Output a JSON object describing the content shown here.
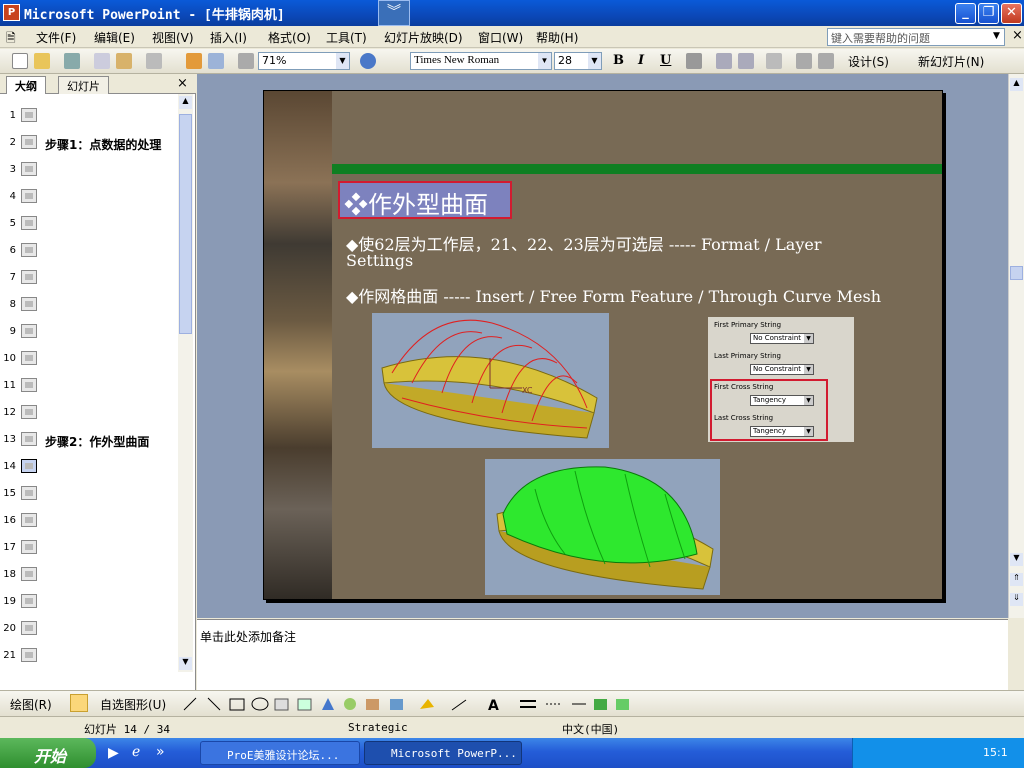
{
  "window": {
    "title": "Microsoft PowerPoint - [牛排锅肉机]",
    "app_icon": "P"
  },
  "menu": {
    "items": [
      "文件(F)",
      "编辑(E)",
      "视图(V)",
      "插入(I)",
      "格式(O)",
      "工具(T)",
      "幻灯片放映(D)",
      "窗口(W)",
      "帮助(H)"
    ],
    "help_placeholder": "键入需要帮助的问题"
  },
  "toolbar": {
    "zoom": "71%",
    "font": "Times New Roman",
    "size": "28",
    "bold": "B",
    "italic": "I",
    "underline": "U",
    "design": "设计(S)",
    "new_slide": "新幻灯片(N)"
  },
  "pane": {
    "tab_outline": "大纲",
    "tab_slides": "幻灯片",
    "rows": [
      {
        "n": "1",
        "t": ""
      },
      {
        "n": "2",
        "t": "步骤1：点数据的处理"
      },
      {
        "n": "3",
        "t": ""
      },
      {
        "n": "4",
        "t": ""
      },
      {
        "n": "5",
        "t": ""
      },
      {
        "n": "6",
        "t": ""
      },
      {
        "n": "7",
        "t": ""
      },
      {
        "n": "8",
        "t": ""
      },
      {
        "n": "9",
        "t": ""
      },
      {
        "n": "10",
        "t": ""
      },
      {
        "n": "11",
        "t": ""
      },
      {
        "n": "12",
        "t": ""
      },
      {
        "n": "13",
        "t": "步骤2：作外型曲面"
      },
      {
        "n": "14",
        "t": ""
      },
      {
        "n": "15",
        "t": ""
      },
      {
        "n": "16",
        "t": ""
      },
      {
        "n": "17",
        "t": ""
      },
      {
        "n": "18",
        "t": ""
      },
      {
        "n": "19",
        "t": ""
      },
      {
        "n": "20",
        "t": ""
      },
      {
        "n": "21",
        "t": ""
      }
    ]
  },
  "slide": {
    "title": "❖作外型曲面",
    "bullet1_line1": "◆使62层为工作层，21、22、23层为可选层          ----- Format / Layer",
    "bullet1_line2": "Settings",
    "bullet2": "◆作网格曲面      ----- Insert / Free Form Feature / Through Curve Mesh",
    "panel": {
      "first_primary": "First Primary String",
      "last_primary": "Last Primary String",
      "first_cross": "First Cross String",
      "last_cross": "Last Cross String",
      "opt_nc": "No Constraint",
      "opt_tan": "Tangency"
    },
    "axis_label": "XC"
  },
  "notes": {
    "placeholder": "单击此处添加备注"
  },
  "drawbar": {
    "draw": "绘图(R)",
    "autoshape": "自选图形(U)"
  },
  "status": {
    "slide_pos": "幻灯片 14 / 34",
    "design": "Strategic",
    "lang": "中文(中国)"
  },
  "taskbar": {
    "start": "开始",
    "task1": "ProE美雅设计论坛...",
    "task2": "Microsoft PowerP...",
    "clock": "15:1"
  },
  "chart_data": {
    "type": "other",
    "title": "作外型曲面",
    "series": []
  }
}
